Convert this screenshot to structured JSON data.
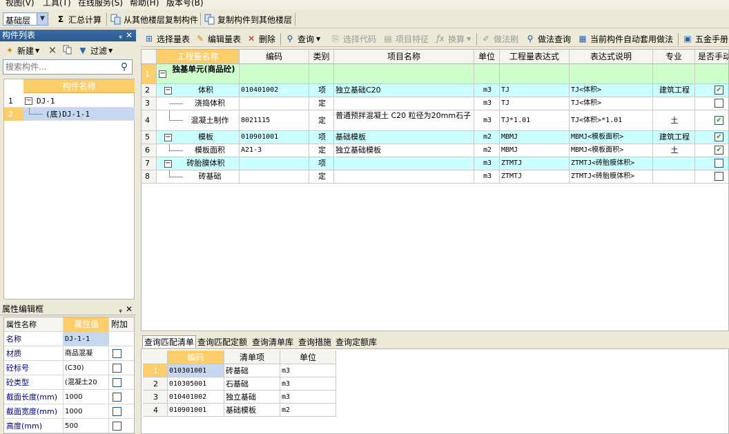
{
  "menu": [
    "视图(V)",
    "工具(T)",
    "在线服务(S)",
    "帮助(H)",
    "版本号(B)"
  ],
  "toolbar": {
    "floor": "基础层",
    "sum": "汇总计算",
    "copy_from": "从其他楼层复制构件",
    "copy_to": "复制构件到其他楼层"
  },
  "comp_panel": {
    "title": "构件列表",
    "new": "新建",
    "filter": "过滤",
    "search_placeholder": "搜索构件...",
    "header": "构件名称",
    "rows": [
      {
        "num": "1",
        "label": "DJ-1"
      },
      {
        "num": "2",
        "label": "(底)DJ-1-1"
      }
    ]
  },
  "prop_panel": {
    "title": "属性编辑框",
    "headers": [
      "属性名称",
      "属性值",
      "附加"
    ],
    "rows": [
      {
        "name": "名称",
        "value": "DJ-1-1"
      },
      {
        "name": "材质",
        "value": "商品混凝"
      },
      {
        "name": "砼标号",
        "value": "(C30)"
      },
      {
        "name": "砼类型",
        "value": "(混凝土20"
      },
      {
        "name": "截面长度(mm)",
        "value": "1000"
      },
      {
        "name": "截面宽度(mm)",
        "value": "1000"
      },
      {
        "name": "高度(mm)",
        "value": "500"
      }
    ]
  },
  "main_tools": {
    "select_table": "选择量表",
    "edit_table": "编辑量表",
    "delete": "删除",
    "query": "查询",
    "select_code": "选择代码",
    "item_feature": "项目特征",
    "convert": "换算",
    "method_brush": "做法刷",
    "method_query": "做法查询",
    "auto_apply": "当前构件自动套用做法",
    "hardware": "五金手册"
  },
  "grid": {
    "headers": [
      "工程量名称",
      "编码",
      "类别",
      "项目名称",
      "单位",
      "工程量表达式",
      "表达式说明",
      "专业",
      "是否手动"
    ],
    "rows": [
      {
        "num": "1",
        "name": "独基单元(商品砼)",
        "code": "",
        "cat": "",
        "proj": "",
        "unit": "",
        "expr": "",
        "desc": "",
        "major": "",
        "check": ""
      },
      {
        "num": "2",
        "name": "体积",
        "code": "010401002",
        "cat": "项",
        "proj": "独立基础C20",
        "unit": "m3",
        "expr": "TJ",
        "desc": "TJ<体积>",
        "major": "建筑工程",
        "check": "✔"
      },
      {
        "num": "3",
        "name": "浇捣体积",
        "code": "",
        "cat": "定",
        "proj": "",
        "unit": "m3",
        "expr": "TJ",
        "desc": "TJ<体积>",
        "major": "",
        "check": ""
      },
      {
        "num": "4",
        "name": "混凝土制作",
        "code": "8021115",
        "cat": "定",
        "proj": "普通预拌混凝土 C20 粒径为20mm石子",
        "unit": "m3",
        "expr": "TJ*1.01",
        "desc": "TJ<体积>*1.01",
        "major": "土",
        "check": "✔"
      },
      {
        "num": "5",
        "name": "模板",
        "code": "010901001",
        "cat": "项",
        "proj": "基础模板",
        "unit": "m2",
        "expr": "MBMJ",
        "desc": "MBMJ<模板面积>",
        "major": "建筑工程",
        "check": "✔"
      },
      {
        "num": "6",
        "name": "模板面积",
        "code": "A21-3",
        "cat": "定",
        "proj": "独立基础模板",
        "unit": "m2",
        "expr": "MBMJ",
        "desc": "MBMJ<模板面积>",
        "major": "土",
        "check": "✔"
      },
      {
        "num": "7",
        "name": "砖胎膜体积",
        "code": "",
        "cat": "项",
        "proj": "",
        "unit": "m3",
        "expr": "ZTMTJ",
        "desc": "ZTMTJ<砖胎膜体积>",
        "major": "",
        "check": ""
      },
      {
        "num": "8",
        "name": "砖基础",
        "code": "",
        "cat": "定",
        "proj": "",
        "unit": "m3",
        "expr": "ZTMTJ",
        "desc": "ZTMTJ<砖胎膜体积>",
        "major": "",
        "check": ""
      }
    ]
  },
  "bottom_tabs": [
    "查询匹配清单",
    "查询匹配定额",
    "查询清单库",
    "查询措施",
    "查询定额库"
  ],
  "bottom_grid": {
    "headers": [
      "编码",
      "清单项",
      "单位"
    ],
    "rows": [
      {
        "num": "1",
        "code": "010301001",
        "item": "砖基础",
        "unit": "m3"
      },
      {
        "num": "2",
        "code": "010305001",
        "item": "石基础",
        "unit": "m3"
      },
      {
        "num": "3",
        "code": "010401002",
        "item": "独立基础",
        "unit": "m3"
      },
      {
        "num": "4",
        "code": "010901001",
        "item": "基础模板",
        "unit": "m2"
      }
    ]
  },
  "colors": {
    "header_orange": "#fbcd6b",
    "row_cyan": "#ccffff",
    "row_green": "#ccffcc",
    "selected_blue": "#c6d8f0",
    "title_blue": "#2b5a8f"
  }
}
